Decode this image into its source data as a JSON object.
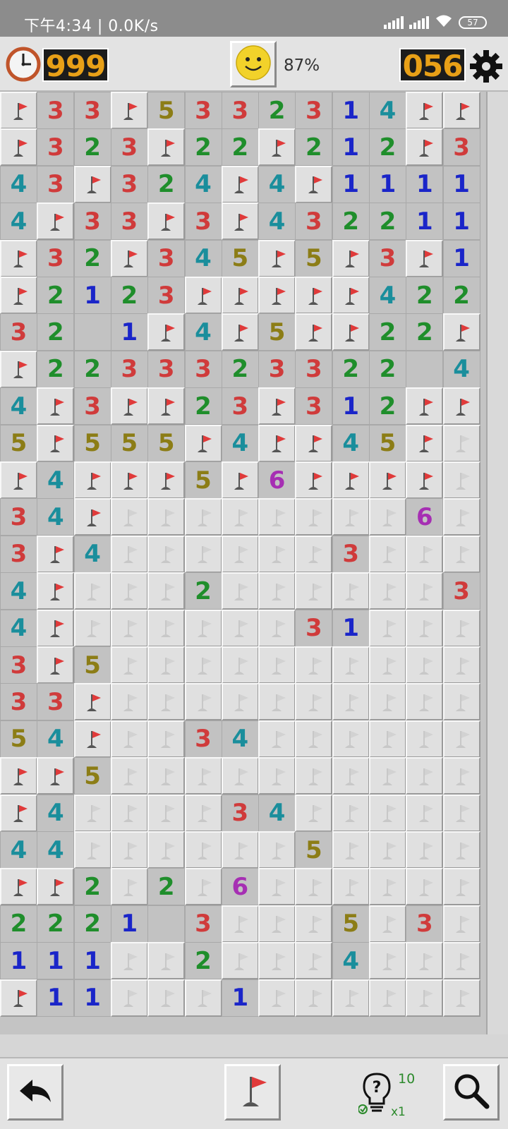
{
  "status_bar": {
    "time": "下午4:34 | 0.0K/s",
    "battery": "57"
  },
  "header": {
    "timer": "999",
    "mines_left": "056",
    "progress": "87%"
  },
  "board": {
    "rows": [
      "F33F5332314FF",
      "F323F22F212F3",
      "43F324F4F1111",
      "4F33F3F432211",
      "F32F345F5F3F1",
      "F2123FFFFF422",
      "32 1F4F5FF22F",
      "F2233323322 4F",
      "4F3FF23F312FF",
      "5F555F4FF45F#",
      "F4FFF5F6FFFF#",
      "34F########6##",
      "3F4######3###",
      "4F###2######3",
      "4F######31###",
      "3F5##########",
      "33F##########",
      "54F##34######",
      "FF5##########",
      "F4####34#####",
      "44######5####",
      "FF2#2#6######",
      "2221 3###5#3##",
      "111##2###4###",
      "F11###1######"
    ],
    "legend": {
      "F": "flag",
      "#": "unopened",
      " ": "empty-open"
    }
  },
  "hint": {
    "count": "10",
    "multiplier": "x1"
  },
  "icons": {
    "timer": "clock-icon",
    "mines": "gear-icon",
    "face": "smiley-face-icon",
    "undo": "undo-arrow-icon",
    "flag_mode": "flag-icon",
    "hint": "lightbulb-question-icon",
    "search": "magnifier-icon"
  },
  "colors": {
    "lcd_digits": "#e8a017",
    "n1": "#1a25c9",
    "n2": "#1f8e2b",
    "n3": "#d03b3b",
    "n4": "#1a8e9c",
    "n5": "#8c7d16",
    "n6": "#a62fb3",
    "flag": "#e03a3a"
  }
}
